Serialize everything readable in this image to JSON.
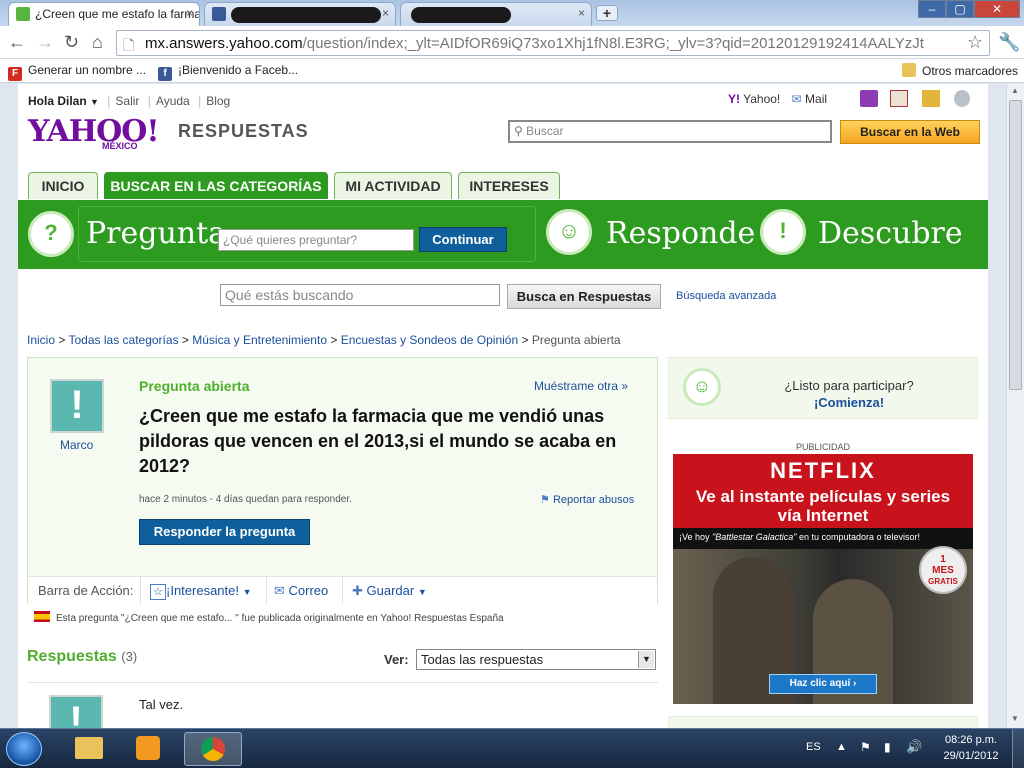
{
  "browser": {
    "tabs": [
      {
        "title": "¿Creen que me estafo la farmacia",
        "close": "×"
      },
      {
        "title": "",
        "close": "×"
      },
      {
        "title": "",
        "close": "×"
      }
    ],
    "new_tab": "+",
    "window_buttons": [
      "–",
      "▢",
      "✕"
    ],
    "url_host": "mx.answers.yahoo.com",
    "url_path": "/question/index;_ylt=AIDfOR69iQ73xo1Xhj1fN8l.E3RG;_ylv=3?qid=20120129192414AALYzJt",
    "bookmarks": [
      {
        "label": "Generar un nombre ...",
        "icon": "F"
      },
      {
        "label": "¡Bienvenido a Faceb...",
        "icon": "f"
      }
    ],
    "other_bookmarks": "Otros marcadores"
  },
  "header": {
    "greeting": "Hola Dilan",
    "links": [
      "Salir",
      "Ayuda",
      "Blog"
    ],
    "yahoo_link": "Yahoo!",
    "mail_link": "Mail",
    "logo": "YAHOO!",
    "logo_sub": "MÉXICO",
    "logo_product": "RESPUESTAS",
    "search_placeholder": "Buscar",
    "search_button": "Buscar en la Web"
  },
  "nav_tabs": [
    {
      "label": "INICIO"
    },
    {
      "label": "BUSCAR EN LAS CATEGORÍAS"
    },
    {
      "label": "MI ACTIVIDAD"
    },
    {
      "label": "INTERESES"
    }
  ],
  "action_band": {
    "ask_word": "Pregunta",
    "ask_placeholder": "¿Qué quieres preguntar?",
    "continue_button": "Continuar",
    "answer_word": "Responde",
    "discover_word": "Descubre"
  },
  "search2": {
    "placeholder": "Qué estás buscando",
    "button": "Busca en Respuestas",
    "advanced": "Búsqueda avanzada"
  },
  "breadcrumb": {
    "items": [
      "Inicio",
      "Todas las categorías",
      "Música y Entretenimiento",
      "Encuestas y Sondeos de Opinión"
    ],
    "current": "Pregunta abierta",
    "sep": ">"
  },
  "question": {
    "author": "Marco",
    "status": "Pregunta abierta",
    "show_another": "Muéstrame otra »",
    "title": "¿Creen que me estafo la farmacia que me vendió unas pildoras que vencen en el 2013,si el mundo se acaba en 2012?",
    "meta": "hace 2 minutos - 4 días quedan para responder.",
    "report": "Reportar abusos",
    "answer_button": "Responder la pregunta"
  },
  "action_bar": {
    "label": "Barra de Acción:",
    "interesting": "¡Interesante!",
    "email": "Correo",
    "save": "Guardar"
  },
  "origin_note": "Esta pregunta \"¿Creen que me estafo... \" fue publicada originalmente en Yahoo! Respuestas España",
  "answers": {
    "heading": "Respuestas",
    "count": "(3)",
    "view_label": "Ver:",
    "view_value": "Todas las respuestas",
    "first_answer": "Tal vez."
  },
  "sidebar": {
    "ready": "¿Listo para participar?",
    "start": "¡Comienza!",
    "ad_label": "PUBLICIDAD",
    "ad_brand": "NETFLIX",
    "ad_headline": "Ve al instante películas y series vía Internet",
    "ad_subline_pre": "¡Ve hoy ",
    "ad_subline_title": "\"Battlestar Galactica\"",
    "ad_subline_post": " en tu computadora o televisor!",
    "ad_badge_top": "1",
    "ad_badge_mid": "MES",
    "ad_badge_bot": "GRATIS",
    "ad_cta": "Haz clic aquí"
  },
  "taskbar": {
    "lang": "ES",
    "time": "08:26 p.m.",
    "date": "29/01/2012"
  },
  "colors": {
    "yahoo_purple": "#720e9e",
    "answers_green": "#2c9b20",
    "link_blue": "#1a4f9c",
    "netflix_red": "#c8121c"
  }
}
